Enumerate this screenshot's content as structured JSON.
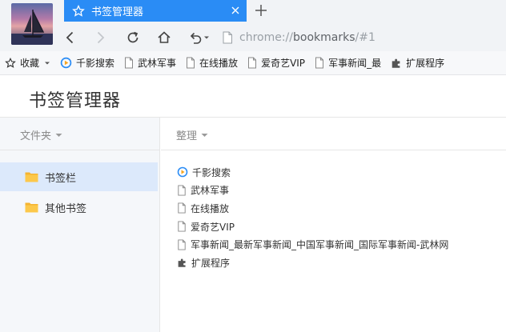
{
  "tab": {
    "title": "书签管理器"
  },
  "address_bar": {
    "scheme": "chrome://",
    "host": "bookmarks",
    "path": "/#1"
  },
  "bookmarks_bar": {
    "favorites_label": "收藏",
    "items": [
      {
        "label": "千影搜索",
        "icon": "search-engine-icon"
      },
      {
        "label": "武林军事",
        "icon": "page-icon"
      },
      {
        "label": "在线播放",
        "icon": "page-icon"
      },
      {
        "label": "爱奇艺VIP",
        "icon": "page-icon"
      },
      {
        "label": "军事新闻_最",
        "icon": "page-icon"
      },
      {
        "label": "扩展程序",
        "icon": "puzzle-icon"
      }
    ]
  },
  "manager": {
    "title": "书签管理器",
    "folders_header": "文件夹",
    "organize_header": "整理",
    "folders": [
      {
        "label": "书签栏",
        "selected": true
      },
      {
        "label": "其他书签",
        "selected": false
      }
    ],
    "entries": [
      {
        "label": "千影搜索",
        "icon": "search-engine-icon"
      },
      {
        "label": "武林军事",
        "icon": "page-icon"
      },
      {
        "label": "在线播放",
        "icon": "page-icon"
      },
      {
        "label": "爱奇艺VIP",
        "icon": "page-icon"
      },
      {
        "label": "军事新闻_最新军事新闻_中国军事新闻_国际军事新闻-武林网",
        "icon": "page-icon"
      },
      {
        "label": "扩展程序",
        "icon": "puzzle-icon"
      }
    ]
  },
  "colors": {
    "tab_active": "#2a8cf5",
    "folder_selected": "#dce9fb",
    "folder_icon": "#f5b431"
  }
}
